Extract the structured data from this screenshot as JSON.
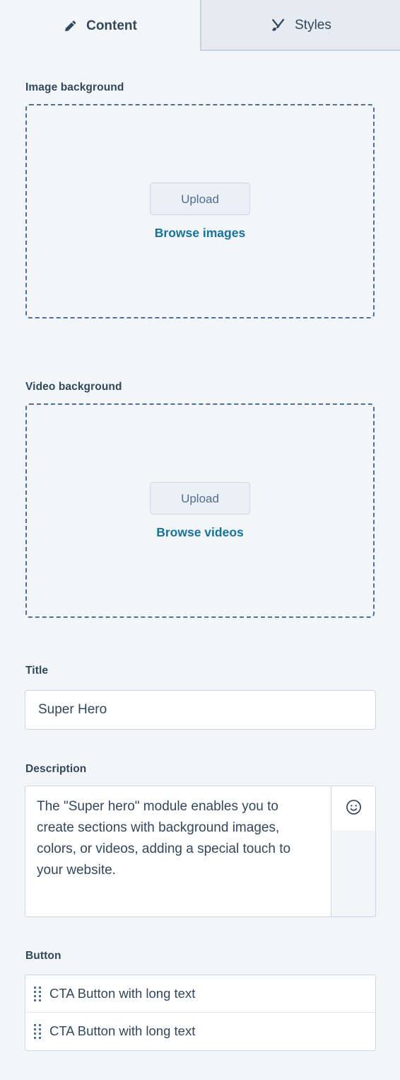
{
  "tabs": [
    {
      "id": "content",
      "label": "Content",
      "icon": "pencil-icon",
      "active": true
    },
    {
      "id": "styles",
      "label": "Styles",
      "icon": "paintbrush-pen-icon",
      "active": false
    }
  ],
  "sections": {
    "image_background": {
      "label": "Image background",
      "upload_label": "Upload",
      "browse_label": "Browse images"
    },
    "video_background": {
      "label": "Video background",
      "upload_label": "Upload",
      "browse_label": "Browse videos"
    },
    "title": {
      "label": "Title",
      "value": "Super Hero",
      "placeholder": "Title"
    },
    "description": {
      "label": "Description",
      "value": "The \"Super hero\" module enables you to create sections with background images, colors, or videos, adding a special touch to your website.",
      "placeholder": "Description",
      "emoji_icon": "smiley-face-icon"
    },
    "button": {
      "label": "Button",
      "items": [
        {
          "label": "CTA Button with long text",
          "handle_icon": "drag-handle-icon"
        },
        {
          "label": "CTA Button with long text",
          "handle_icon": "drag-handle-icon"
        }
      ]
    }
  },
  "colors": {
    "page_background": "#f2f6f9",
    "inactive_tab_background": "#e5ebf0",
    "border": "#cbd6e2",
    "text": "#33475b",
    "link_teal": "#17739b",
    "dashed_border": "#516f90",
    "upload_button_background": "#eaf0f6"
  }
}
